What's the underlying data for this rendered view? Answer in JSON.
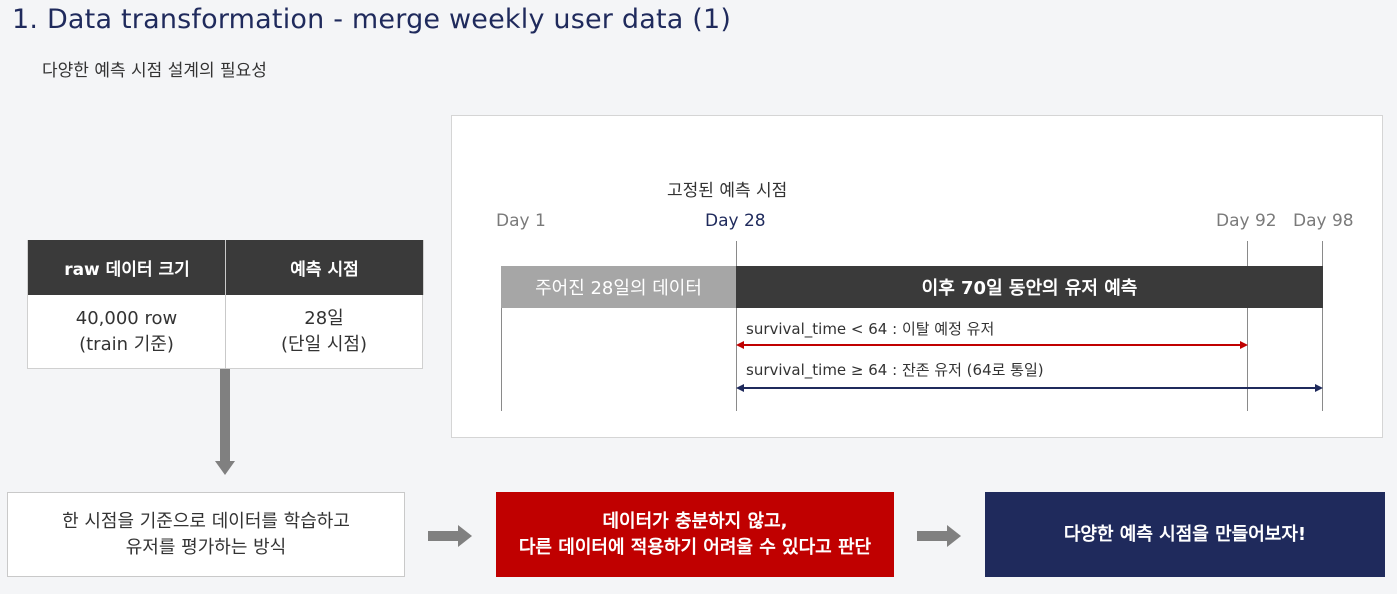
{
  "header": {
    "title": "1. Data transformation - merge weekly user data (1)",
    "subtitle": "다양한 예측 시점 설계의 필요성"
  },
  "table": {
    "headers": [
      "raw 데이터 크기",
      "예측 시점"
    ],
    "cells": [
      {
        "line1": "40,000 row",
        "line2": "(train 기준)"
      },
      {
        "line1": "28일",
        "line2": "(단일 시점)"
      }
    ]
  },
  "timeline": {
    "fixed_label": "고정된 예측 시점",
    "day_labels": {
      "d1": "Day 1",
      "d28": "Day 28",
      "d92": "Day 92",
      "d98": "Day 98"
    },
    "given_data_label": "주어진 28일의 데이터",
    "prediction_label": "이후 70일 동안의 유저 예측",
    "churn_label": "survival_time < 64 : 이탈 예정 유저",
    "retain_label": "survival_time ≥ 64 : 잔존 유저 (64로 통일)",
    "colors": {
      "churn": "#c00000",
      "retain": "#1f2a5c",
      "bar_gray": "#a6a6a6",
      "bar_dark": "#3a3a3a"
    }
  },
  "flow": {
    "step1": {
      "line1": "한 시점을 기준으로 데이터를 학습하고",
      "line2": "유저를 평가하는 방식"
    },
    "step2": {
      "line1": "데이터가 충분하지 않고,",
      "line2": "다른 데이터에 적용하기 어려울 수 있다고 판단"
    },
    "step3": {
      "line1": "다양한 예측 시점을 만들어보자!"
    },
    "colors": {
      "step2_bg": "#c00000",
      "step3_bg": "#1f2a5c",
      "arrow": "#808080"
    }
  }
}
